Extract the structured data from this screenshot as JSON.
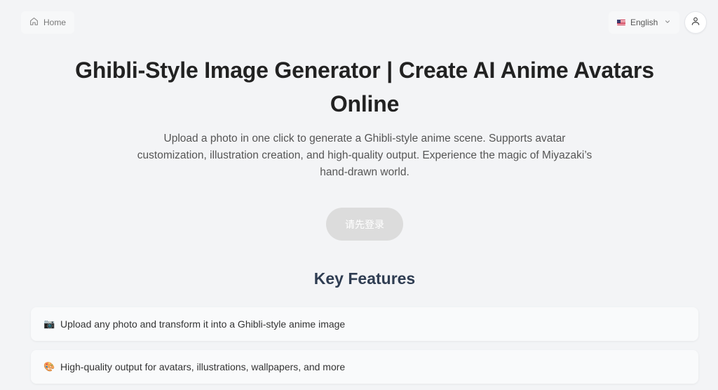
{
  "nav": {
    "home_label": "Home",
    "language_label": "English",
    "home_icon": "home-icon",
    "language_flag_icon": "us-flag-icon",
    "chevron_icon": "chevron-down-icon",
    "user_icon": "user-icon"
  },
  "hero": {
    "title_line1": "Ghibli-Style Image Generator | Create AI Anime Avatars",
    "title_line2": "Online",
    "subtitle": "Upload a photo in one click to generate a Ghibli-style anime scene. Supports avatar customization, illustration creation, and high-quality output. Experience the magic of Miyazaki’s hand-drawn world.",
    "cta_label": "请先登录"
  },
  "features": {
    "heading": "Key Features",
    "items": [
      {
        "emoji": "📷",
        "text": "Upload any photo and transform it into a Ghibli-style anime image"
      },
      {
        "emoji": "🎨",
        "text": "High-quality output for avatars, illustrations, wallpapers, and more"
      }
    ]
  },
  "colors": {
    "background": "#f3f4f6",
    "heading": "#2f3d52",
    "cta_disabled": "#dcdcdc"
  }
}
